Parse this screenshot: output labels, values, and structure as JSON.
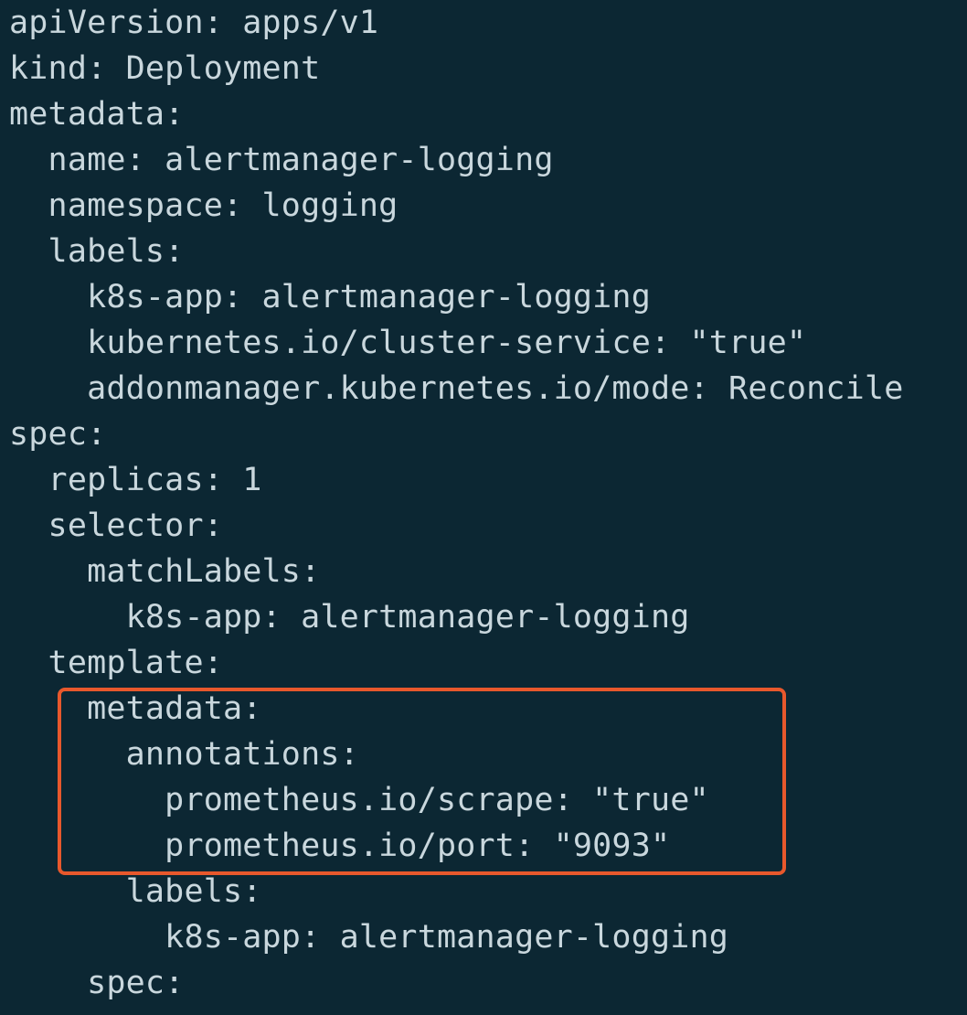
{
  "editor": {
    "background_color": "#0c2733",
    "text_color": "#c9d7dd",
    "highlight_color": "#e8582c",
    "lines": [
      "apiVersion: apps/v1",
      "kind: Deployment",
      "metadata:",
      "  name: alertmanager-logging",
      "  namespace: logging",
      "  labels:",
      "    k8s-app: alertmanager-logging",
      "    kubernetes.io/cluster-service: \"true\"",
      "    addonmanager.kubernetes.io/mode: Reconcile",
      "spec:",
      "  replicas: 1",
      "  selector:",
      "    matchLabels:",
      "      k8s-app: alertmanager-logging",
      "  template:",
      "    metadata:",
      "      annotations:",
      "        prometheus.io/scrape: \"true\"",
      "        prometheus.io/port: \"9093\"",
      "      labels:",
      "        k8s-app: alertmanager-logging",
      "    spec:"
    ]
  }
}
